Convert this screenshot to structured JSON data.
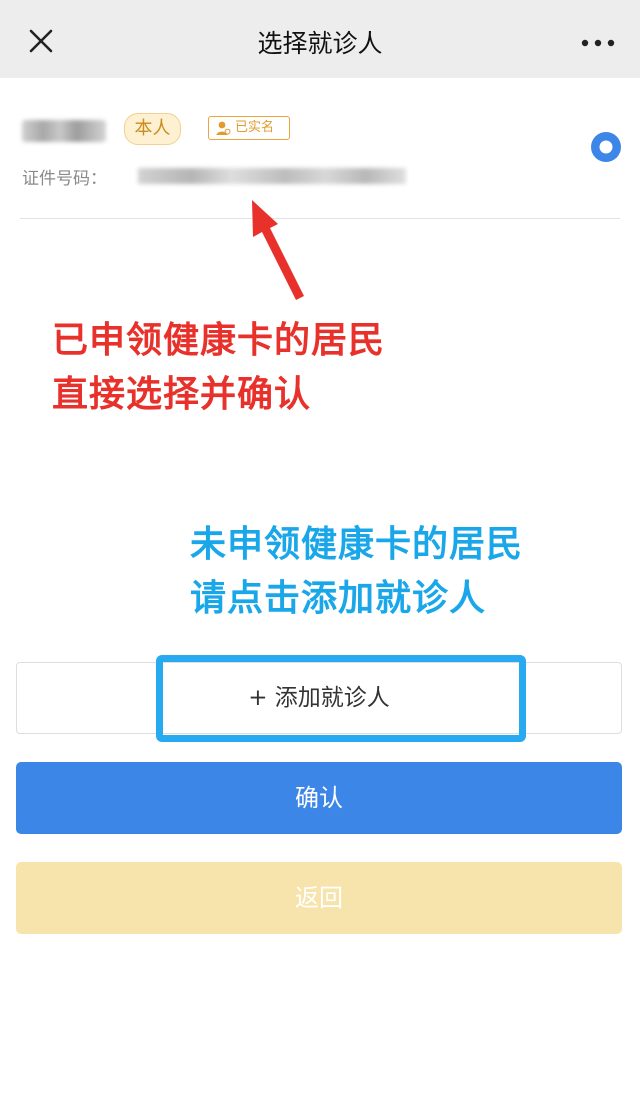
{
  "header": {
    "title": "选择就诊人",
    "close_icon": "close-icon",
    "more_icon": "more-horizontal-icon"
  },
  "patient": {
    "self_tag": "本人",
    "verified_tag": "已实名",
    "verified_icon": "person-icon",
    "id_label": "证件号码：",
    "selected": true
  },
  "annotations": {
    "red": [
      "已申领健康卡的居民",
      "直接选择并确认"
    ],
    "blue": [
      "未申领健康卡的居民",
      "请点击添加就诊人"
    ]
  },
  "actions": {
    "add_label": "+ 添加就诊人",
    "confirm_label": "确认",
    "back_label": "返回"
  },
  "colors": {
    "primary": "#3b86e6",
    "back_button": "#f7e4ac",
    "tag_orange": "#e39b2e",
    "annotation_red": "#e8312b",
    "annotation_blue": "#1aa7ea"
  }
}
